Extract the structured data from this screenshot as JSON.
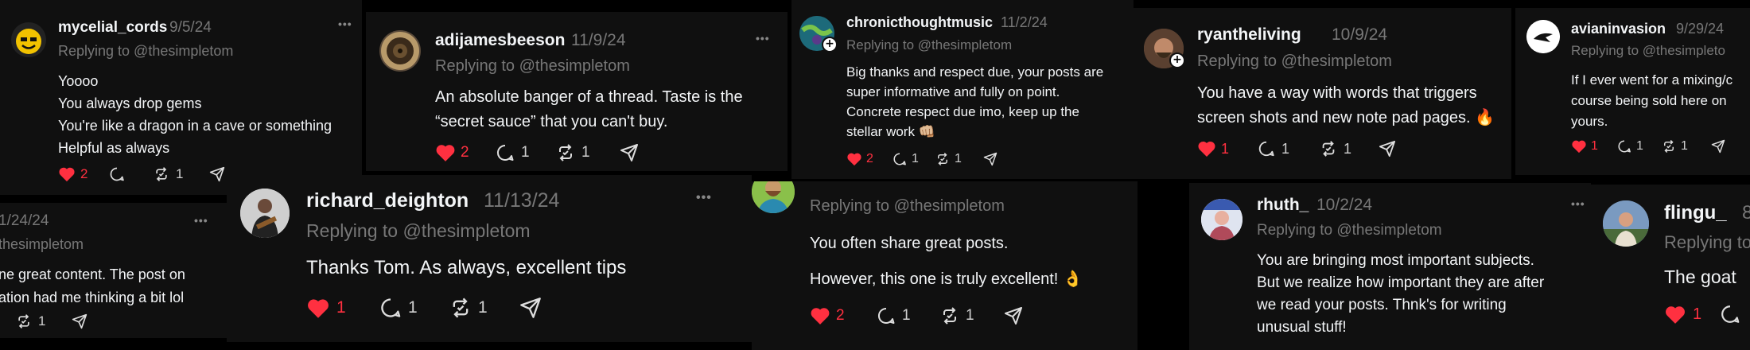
{
  "colors": {
    "background": "#000000",
    "card": "#101010",
    "like": "#ff3040",
    "muted": "#777777",
    "text": "#f3f5f7"
  },
  "more_label": "•••",
  "posts": [
    {
      "username": "mycelial_cords",
      "date": "9/5/24",
      "reply_to": "Replying to @thesimpletom",
      "lines": [
        "Yoooo",
        "You always drop gems",
        "You're like a dragon in a cave or something",
        "Helpful as always"
      ],
      "likes": "2",
      "comments": "",
      "reposts": "1",
      "liked": true
    },
    {
      "username": "",
      "date": "1/24/24",
      "reply_to": "thesimpletom",
      "lines": [
        "ne great content. The post on",
        "ation had me thinking a bit lol"
      ],
      "likes": "",
      "comments": "",
      "reposts": "1",
      "liked": false
    },
    {
      "username": "adijamesbeeson",
      "date": "11/9/24",
      "reply_to": "Replying to @thesimpletom",
      "lines": [
        "An absolute banger of a thread. Taste is the",
        "“secret sauce” that you can't buy."
      ],
      "likes": "2",
      "comments": "1",
      "reposts": "1",
      "liked": true
    },
    {
      "username": "richard_deighton",
      "date": "11/13/24",
      "reply_to": "Replying to @thesimpletom",
      "lines": [
        "Thanks Tom. As always, excellent tips"
      ],
      "likes": "1",
      "comments": "1",
      "reposts": "1",
      "liked": true
    },
    {
      "username": "chronicthoughtmusic",
      "date": "11/2/24",
      "reply_to": "Replying to @thesimpletom",
      "lines": [
        "Big thanks and respect due, your posts are",
        "super informative and fully on point.",
        "Concrete respect due imo, keep up the",
        "stellar work"
      ],
      "emoji": "👊🏼",
      "likes": "2",
      "comments": "1",
      "reposts": "1",
      "liked": true
    },
    {
      "username": "",
      "date": "",
      "reply_to": "Replying to @thesimpletom",
      "lines": [
        "You often share great posts.",
        "However, this one is truly excellent!"
      ],
      "emoji": "👌",
      "likes": "2",
      "comments": "1",
      "reposts": "1",
      "liked": true
    },
    {
      "username": "ryantheliving",
      "date": "10/9/24",
      "reply_to": "Replying to @thesimpletom",
      "lines": [
        "You have a way with words that triggers",
        "screen shots and new note pad pages."
      ],
      "emoji": "🔥",
      "likes": "1",
      "comments": "1",
      "reposts": "1",
      "liked": true
    },
    {
      "username": "rhuth_",
      "date": "10/2/24",
      "reply_to": "Replying to @thesimpletom",
      "lines": [
        "You are bringing most important subjects.",
        "But we realize how important they are after",
        "we read your posts. Thnk's for writing",
        "unusual stuff!"
      ],
      "likes": "",
      "comments": "",
      "reposts": "",
      "liked": false
    },
    {
      "username": "avianinvasion",
      "date": "9/29/24",
      "reply_to": "Replying to @thesimpleto",
      "lines": [
        "If I ever went for a mixing/c",
        "course being sold here on",
        "yours."
      ],
      "likes": "1",
      "comments": "1",
      "reposts": "1",
      "liked": true
    },
    {
      "username": "flingu_",
      "date": "8",
      "reply_to": "Replying to",
      "lines": [
        "The goat"
      ],
      "likes": "1",
      "comments": "",
      "reposts": "",
      "liked": true
    }
  ]
}
